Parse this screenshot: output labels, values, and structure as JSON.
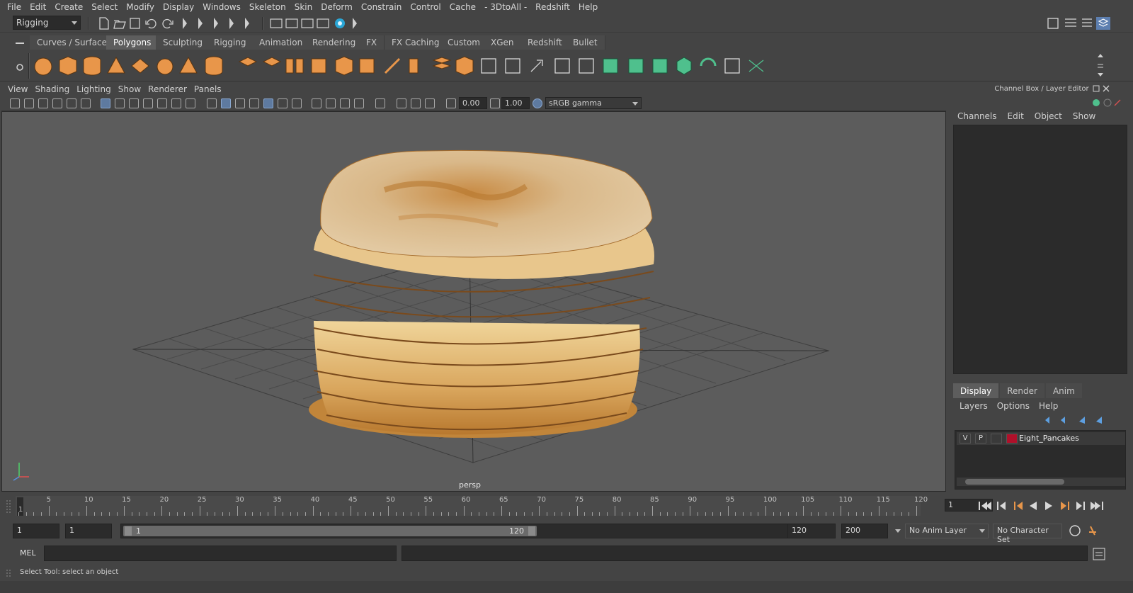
{
  "menubar": {
    "items": [
      "File",
      "Edit",
      "Create",
      "Select",
      "Modify",
      "Display",
      "Windows",
      "Skeleton",
      "Skin",
      "Deform",
      "Constrain",
      "Control",
      "Cache",
      "- 3DtoAll -",
      "Redshift",
      "Help"
    ]
  },
  "statusline": {
    "menuset": "Rigging"
  },
  "shelf": {
    "tabs": [
      "Curves / Surfaces",
      "Polygons",
      "Sculpting",
      "Rigging",
      "Animation",
      "Rendering",
      "FX",
      "FX Caching",
      "Custom",
      "XGen",
      "Redshift",
      "Bullet"
    ],
    "active_tab": "Polygons"
  },
  "viewport": {
    "menu": [
      "View",
      "Shading",
      "Lighting",
      "Show",
      "Renderer",
      "Panels"
    ],
    "exposure": "0.00",
    "gamma": "1.00",
    "colorspace": "sRGB gamma",
    "camera_label": "persp"
  },
  "channelbox": {
    "title": "Channel Box / Layer Editor",
    "menu": [
      "Channels",
      "Edit",
      "Object",
      "Show"
    ]
  },
  "layer_editor": {
    "tabs": [
      "Display",
      "Render",
      "Anim"
    ],
    "active_tab": "Display",
    "menu": [
      "Layers",
      "Options",
      "Help"
    ],
    "layer": {
      "visible": "V",
      "playback": "P",
      "name": "Eight_Pancakes",
      "color": "#b0102a"
    }
  },
  "timeline": {
    "ticks": [
      "5",
      "10",
      "15",
      "20",
      "25",
      "30",
      "35",
      "40",
      "45",
      "50",
      "55",
      "60",
      "65",
      "70",
      "75",
      "80",
      "85",
      "90",
      "95",
      "100",
      "105",
      "110",
      "115",
      "120"
    ],
    "start_label": "1",
    "current_frame": "1"
  },
  "range": {
    "start": "1",
    "anim_start": "1",
    "slider_start": "1",
    "slider_end": "120",
    "anim_end": "120",
    "end": "200",
    "anim_layer": "No Anim Layer",
    "character_set": "No Character Set"
  },
  "commandline": {
    "lang": "MEL"
  },
  "helpline": {
    "text": "Select Tool: select an object"
  },
  "colors": {
    "ui_bg": "#444444",
    "viewport_bg": "#5c5c5c",
    "accent": "#5d7fb0",
    "shelf_icon": "#e8964a",
    "shelf_icon_green": "#4fc08d"
  }
}
